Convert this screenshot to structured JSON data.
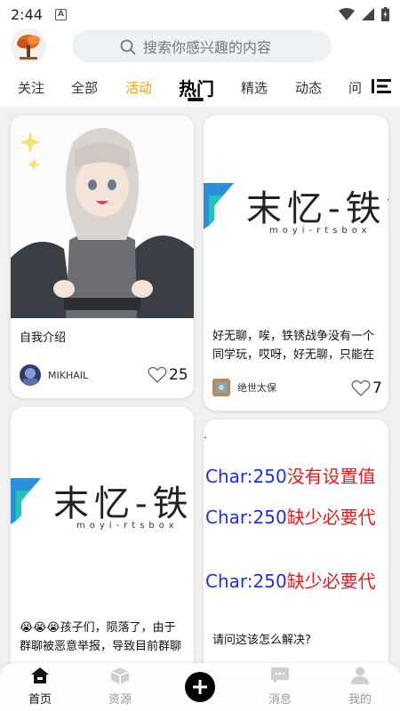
{
  "status": {
    "time": "2:44"
  },
  "search": {
    "placeholder": "搜索你感兴趣的内容"
  },
  "tabs": [
    {
      "label": "关注"
    },
    {
      "label": "全部"
    },
    {
      "label": "活动"
    },
    {
      "label": "热门"
    },
    {
      "label": "精选"
    },
    {
      "label": "动态"
    },
    {
      "label": "问"
    }
  ],
  "posts": [
    {
      "title": "自我介绍",
      "author": "MIKHAIL",
      "likes": "25"
    },
    {
      "title_line1": "好无聊，唉，铁锈战争没有一个",
      "title_line2": "同学玩，哎呀，好无聊，只能在",
      "author": "绝世太保",
      "likes": "7",
      "banner_big": "末忆-铁锈",
      "banner_small": "moyi-rtsbox"
    },
    {
      "title_line1": "😭😭😭孩子们，陨落了，由于",
      "title_line2": "群聊被恶意举报，导致目前群聊",
      "banner_big": "末忆-铁锈",
      "banner_small": "moyi-rtsbox"
    },
    {
      "lines": [
        {
          "blue": "Char:250",
          "red": "没有设置值"
        },
        {
          "blue": "Char:250",
          "red": "缺少必要代"
        },
        {
          "blue": "Char:250",
          "red": "缺少必要代"
        }
      ],
      "title": "请问这该怎么解决?"
    }
  ],
  "nav": [
    {
      "label": "首页"
    },
    {
      "label": "资源"
    },
    {
      "label": "消息"
    },
    {
      "label": "我的"
    }
  ],
  "colors": {
    "accent": "#f5a100",
    "link_blue": "#1e2fe0",
    "error_red": "#e01d1d"
  }
}
